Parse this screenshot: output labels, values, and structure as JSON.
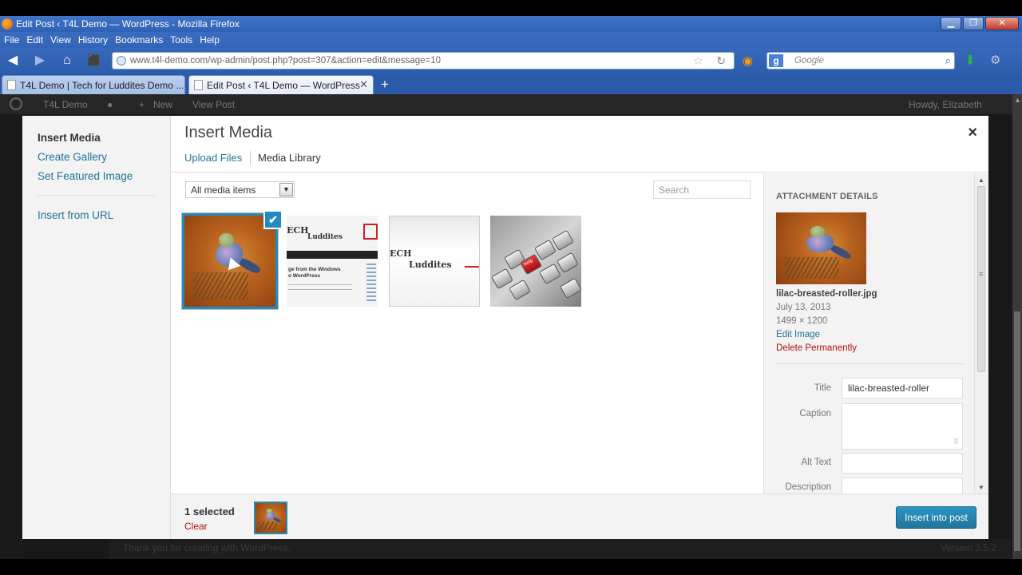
{
  "browser": {
    "window_title": "Edit Post ‹ T4L Demo — WordPress - Mozilla Firefox",
    "menu": [
      "File",
      "Edit",
      "View",
      "History",
      "Bookmarks",
      "Tools",
      "Help"
    ],
    "url": "www.t4l-demo.com/wp-admin/post.php?post=307&action=edit&message=10",
    "search_placeholder": "Google",
    "search_engine_letter": "g",
    "tabs": [
      {
        "label": "T4L Demo | Tech for Luddites Demo ...",
        "active": false
      },
      {
        "label": "Edit Post ‹ T4L Demo — WordPress",
        "active": true
      }
    ]
  },
  "wp_admin_bar": {
    "site_name": "T4L Demo",
    "new_label": "New",
    "view_post_label": "View Post",
    "howdy": "Howdy, Elizabeth"
  },
  "wp_footer": {
    "thanks": "Thank you for creating with WordPress.",
    "version": "Version 3.5.2"
  },
  "modal": {
    "title": "Insert Media",
    "close_glyph": "×",
    "menu": [
      {
        "label": "Insert Media",
        "active": true
      },
      {
        "label": "Create Gallery",
        "active": false
      },
      {
        "label": "Set Featured Image",
        "active": false
      },
      {
        "label": "Insert from URL",
        "active": false
      }
    ],
    "router_tabs": [
      {
        "label": "Upload Files",
        "active": false
      },
      {
        "label": "Media Library",
        "active": true
      }
    ],
    "filter_selected": "All media items",
    "search_placeholder": "Search",
    "attachments": [
      {
        "name": "bird-photo",
        "selected": true
      },
      {
        "name": "tech-luddites-screenshot",
        "selected": false
      },
      {
        "name": "tech-luddites-header",
        "selected": false
      },
      {
        "name": "keyboard-help-key",
        "selected": false
      }
    ],
    "check_glyph": "✔",
    "details": {
      "heading": "ATTACHMENT DETAILS",
      "filename": "lilac-breasted-roller.jpg",
      "date": "July 13, 2013",
      "dimensions": "1499 × 1200",
      "edit_image": "Edit Image",
      "delete": "Delete Permanently",
      "fields": [
        {
          "label": "Title",
          "value": "lilac-breasted-roller"
        },
        {
          "label": "Caption",
          "value": ""
        },
        {
          "label": "Alt Text",
          "value": ""
        },
        {
          "label": "Description",
          "value": ""
        }
      ]
    },
    "selection": {
      "count_text": "1 selected",
      "clear_text": "Clear"
    },
    "insert_button": "Insert into post",
    "thumb_text": {
      "logo_a": "ECH",
      "logo_b": "Luddites",
      "snippet": "ge from the Windows",
      "snippet2": "o WordPress",
      "key_label": "Help"
    }
  },
  "colors": {
    "accent": "#1e8cbe",
    "link": "#21759b",
    "danger": "#bc0b0b"
  }
}
